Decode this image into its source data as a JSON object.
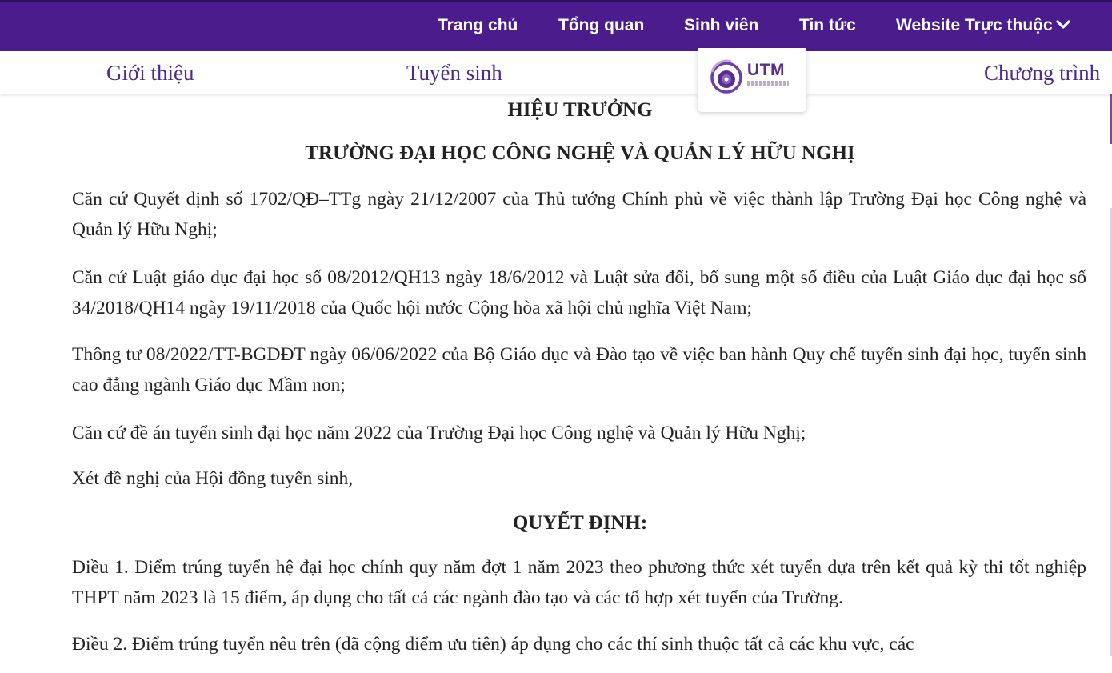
{
  "top_nav": {
    "items": [
      "Trang chủ",
      "Tổng quan",
      "Sinh viên",
      "Tin tức",
      "Website Trực thuộc"
    ],
    "bg_color": "#4b1d8c"
  },
  "sub_nav": {
    "items": [
      "Giới thiệu",
      "Tuyển sinh",
      "Chương trình"
    ],
    "logo_text": "UTM",
    "text_color": "#4b2a8a"
  },
  "document": {
    "heading_1": "HIỆU TRƯỞNG",
    "heading_2": "TRƯỜNG ĐẠI HỌC CÔNG NGHỆ VÀ QUẢN LÝ HỮU NGHỊ",
    "paragraphs": [
      "Căn cứ Quyết định số 1702/QĐ–TTg ngày 21/12/2007 của Thủ tướng Chính phủ về việc thành lập Trường Đại học Công nghệ và Quản lý Hữu Nghị;",
      "Căn cứ Luật giáo dục đại học số 08/2012/QH13 ngày 18/6/2012 và Luật sửa đổi, bổ sung một số điều của Luật Giáo dục đại học số 34/2018/QH14 ngày 19/11/2018 của Quốc hội nước Cộng hòa xã hội chủ nghĩa Việt Nam;",
      "Thông tư 08/2022/TT-BGDĐT ngày 06/06/2022 của Bộ Giáo dục và Đào tạo về việc ban hành Quy chế tuyển sinh đại học, tuyển sinh cao đẳng ngành Giáo dục Mầm non;",
      "Căn cứ đề án tuyển sinh đại học năm 2022 của Trường Đại học Công nghệ và Quản lý Hữu Nghị;",
      "Xét đề nghị của Hội đồng tuyển sinh,"
    ],
    "decision_heading": "QUYẾT ĐỊNH:",
    "articles": [
      "Điều 1. Điểm trúng tuyển hệ đại học chính quy năm đợt 1 năm 2023 theo phương thức xét tuyển dựa trên kết quả kỳ thi tốt nghiệp THPT năm 2023 là 15 điểm, áp dụng cho tất cả các ngành đào tạo và các tổ hợp xét tuyển của Trường.",
      "Điều 2. Điểm trúng tuyển nêu trên (đã cộng điểm ưu tiên) áp dụng cho các thí sinh thuộc tất cả các khu vực, các"
    ]
  }
}
